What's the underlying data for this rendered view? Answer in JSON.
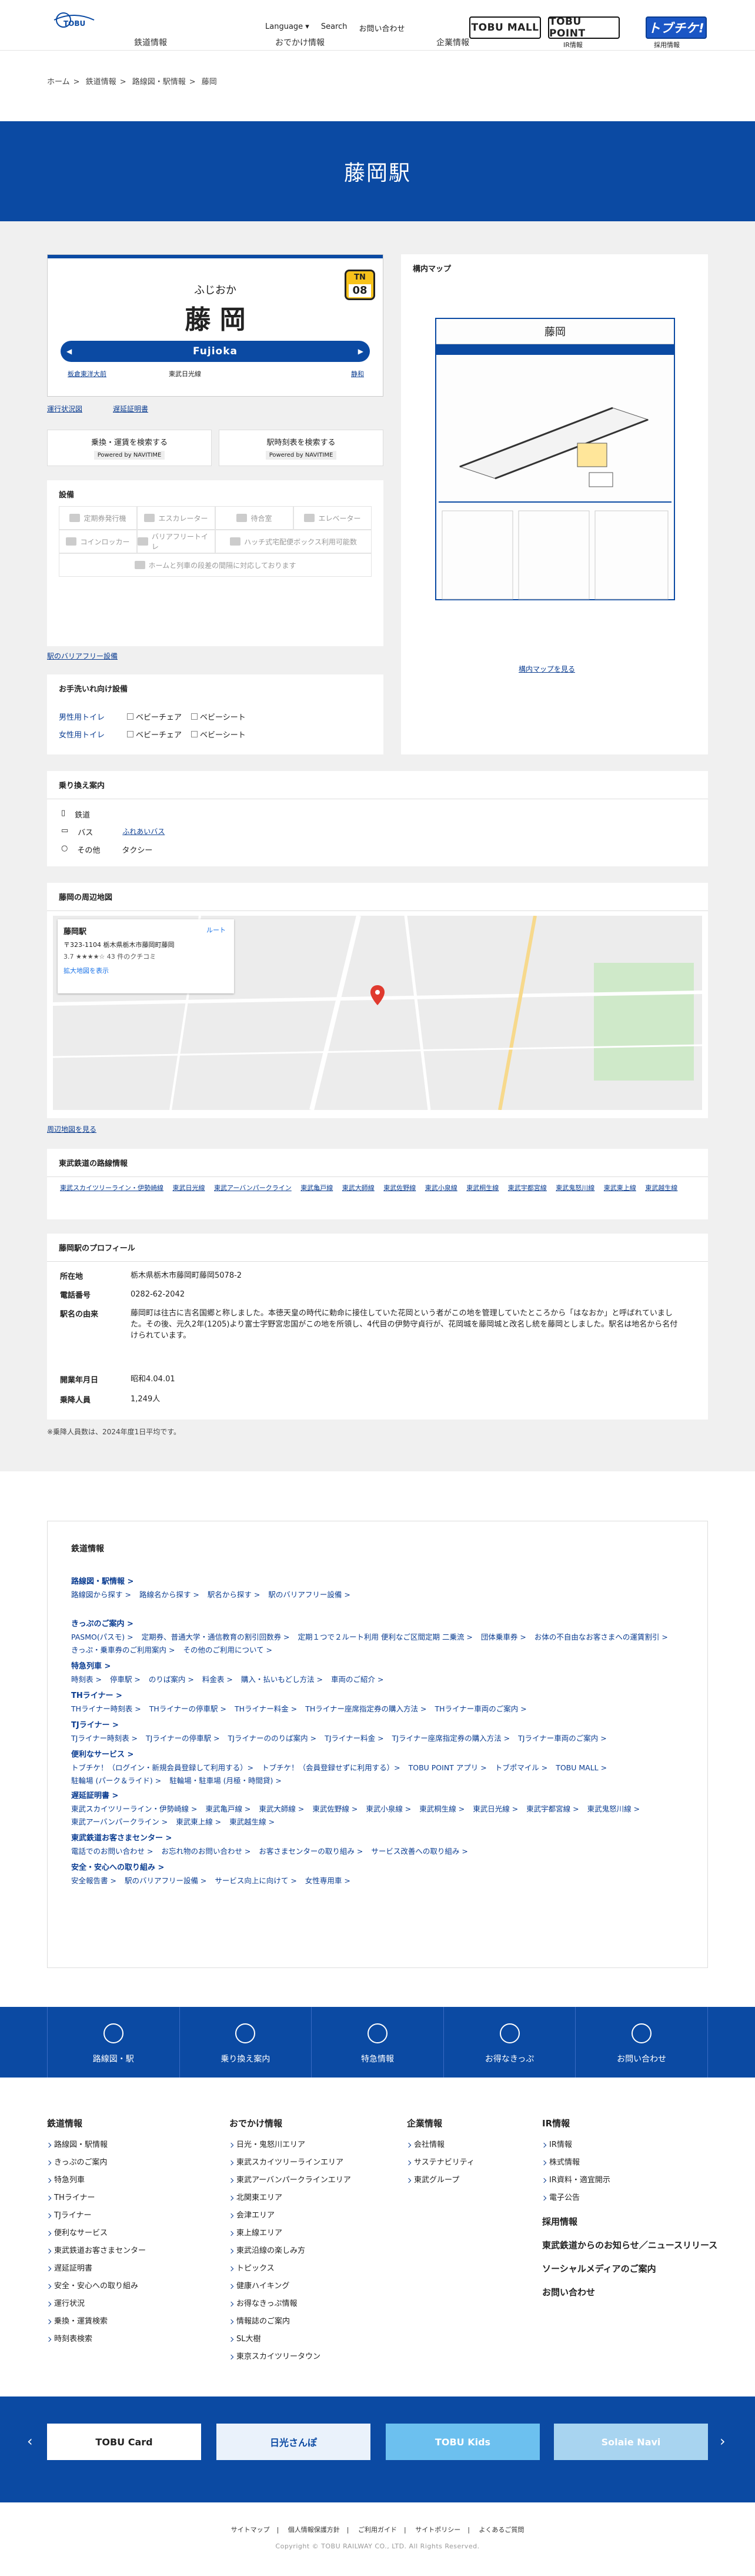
{
  "header": {
    "top": [
      "Language ▾",
      "Search",
      "お問い合わせ"
    ],
    "main": [
      "鉄道情報",
      "おでかけ情報",
      "企業情報"
    ],
    "brands": {
      "tobumall": "TOBU MALL",
      "tobupoint": "TOBU POINT",
      "topuchike": "トブチケ!"
    },
    "brand_subs": [
      "IR情報",
      "採用情報"
    ]
  },
  "breadcrumb": [
    "ホーム",
    "鉄道情報",
    "路線図・駅情報",
    "藤岡"
  ],
  "page_title": "藤岡駅",
  "sign": {
    "kana": "ふじおか",
    "kanji": "藤 岡",
    "romaji": "Fujioka",
    "code_prefix": "TN",
    "code_num": "08",
    "prev": "板倉東洋大前",
    "line": "東武日光線",
    "next": "静和"
  },
  "links": {
    "timetable": "運行状況図",
    "delay": "遅延証明書"
  },
  "search_buttons": [
    {
      "label": "乗換・運賃を検索する",
      "powered": "Powered by NAVITIME"
    },
    {
      "label": "駅時刻表を検索する",
      "powered": "Powered by NAVITIME"
    }
  ],
  "facilities": {
    "title": "設備",
    "items": [
      "定期券発行機",
      "エスカレーター",
      "待合室",
      "エレベーター",
      "コインロッカー",
      "バリアフリートイレ",
      "ハッチ式宅配便ボックス利用可能数",
      "ホームと列車の段差の間隔に対応しております"
    ],
    "link": "駅のバリアフリー設備"
  },
  "station_map": {
    "title": "構内マップ",
    "map_title": "藤岡",
    "link": "構内マップを見る"
  },
  "toilet": {
    "title": "お手洗いれ向け設備",
    "rows": [
      {
        "label": "男性用トイレ",
        "opts": [
          "ベビーチェア",
          "ベビーシート"
        ]
      },
      {
        "label": "女性用トイレ",
        "opts": [
          "ベビーチェア",
          "ベビーシート"
        ]
      }
    ]
  },
  "transfer": {
    "title": "乗り換え案内",
    "rows": [
      {
        "k": "鉄道",
        "v": ""
      },
      {
        "k": "バス",
        "v": "ふれあいバス"
      },
      {
        "k": "その他",
        "v": "タクシー"
      }
    ]
  },
  "nearmap": {
    "title": "藤岡の周辺地図",
    "info_name": "藤岡駅",
    "info_addr": "〒323-1104 栃木県栃木市藤岡町藤岡",
    "info_rating": "3.7 ★★★★☆ 43 件のクチコミ",
    "info_route": "ルート",
    "info_link": "拡大地図を表示",
    "link": "周辺地図を見る"
  },
  "routes": {
    "title": "東武鉄道の路線情報",
    "items": [
      "東武スカイツリーライン・伊勢崎線",
      "東武日光線",
      "東武アーバンパークライン",
      "東武亀戸線",
      "東武大師線",
      "東武佐野線",
      "東武小泉線",
      "東武桐生線",
      "東武宇都宮線",
      "東武鬼怒川線",
      "東武東上線",
      "東武越生線"
    ]
  },
  "profile": {
    "title": "藤岡駅のプロフィール",
    "rows": [
      {
        "k": "所在地",
        "v": "栃木県栃木市藤岡町藤岡5078-2"
      },
      {
        "k": "電話番号",
        "v": "0282-62-2042"
      },
      {
        "k": "駅名の由来",
        "v": "藤岡町は往古に吉名国郷と称しました。本徳天皇の時代に勅命に接住していた花岡という者がこの地を管理していたところから「はなおか」と呼ばれていました。その後、元久2年(1205)より富士字野宮忠国がこの地を所領し、4代目の伊勢守貞行が、花岡城を藤岡城と改名し統を藤岡としました。駅名は地名から名付けられています。"
      },
      {
        "k": "開業年月日",
        "v": "昭和4.04.01"
      },
      {
        "k": "乗降人員",
        "v": "1,249人"
      }
    ],
    "note": "※乗降人員数は、2024年度1日平均です。"
  },
  "railinfo": {
    "title": "鉄道情報",
    "groups": [
      {
        "t": "路線図・駅情報 >",
        "links": [
          "路線図から探す >",
          "路線名から探す >",
          "駅名から探す >",
          "駅のバリアフリー設備 >"
        ]
      },
      {
        "t": "きっぷのご案内 >",
        "links": [
          "PASMO(パスモ) >",
          "定期券、普通大学・通信教育の割引回数券 >",
          "定期１つで２ルート利用 便利なご区間定期 二乗流 >",
          "団体乗車券 >",
          "お体の不自由なお客さまへの運賃割引 >",
          "きっぷ・乗車券のご利用案内 >",
          "その他のご利用について >"
        ]
      },
      {
        "t": "特急列車 >",
        "links": [
          "時刻表 >",
          "停車駅 >",
          "のりば案内 >",
          "料金表 >",
          "購入・払いもどし方法 >",
          "車両のご紹介 >"
        ]
      },
      {
        "t": "THライナー >",
        "links": [
          "THライナー時刻表 >",
          "THライナーの停車駅 >",
          "THライナー料金 >",
          "THライナー座席指定券の購入方法 >",
          "THライナー車両のご案内 >"
        ]
      },
      {
        "t": "TJライナー >",
        "links": [
          "TJライナー時刻表 >",
          "TJライナーの停車駅 >",
          "TJライナーののりば案内 >",
          "TJライナー料金 >",
          "TJライナー座席指定券の購入方法 >",
          "TJライナー車両のご案内 >"
        ]
      },
      {
        "t": "便利なサービス >",
        "links": [
          "トブチケ！（ログイン・新規会員登録して利用する）>",
          "トブチケ！（会員登録せずに利用する）>",
          "TOBU POINT アプリ >",
          "トブポマイル >",
          "TOBU MALL >",
          "駐輪場 (パーク＆ライド) >",
          "駐輪場・駐車場 (月極・時間貸) >"
        ]
      },
      {
        "t": "遅延証明書 >",
        "links": [
          "東武スカイツリーライン・伊勢崎線 >",
          "東武亀戸線 >",
          "東武大師線 >",
          "東武佐野線 >",
          "東武小泉線 >",
          "東武桐生線 >",
          "東武日光線 >",
          "東武宇都宮線 >",
          "東武鬼怒川線 >",
          "東武アーバンパークライン >",
          "東武東上線 >",
          "東武越生線 >"
        ]
      },
      {
        "t": "東武鉄道お客さまセンター >",
        "links": [
          "電話でのお問い合わせ >",
          "お忘れ物のお問い合わせ >",
          "お客さまセンターの取り組み >",
          "サービス改善への取り組み >"
        ]
      },
      {
        "t": "安全・安心への取り組み >",
        "links": [
          "安全報告書 >",
          "駅のバリアフリー設備 >",
          "サービス向上に向けて >",
          "女性専用車 >"
        ]
      }
    ]
  },
  "band": [
    "路線図・駅",
    "乗り換え案内",
    "特急情報",
    "お得なきっぷ",
    "お問い合わせ"
  ],
  "footer": {
    "col1": {
      "h": "鉄道情報",
      "items": [
        "路線図・駅情報",
        "きっぷのご案内",
        "特急列車",
        "THライナー",
        "TJライナー",
        "便利なサービス",
        "東武鉄道お客さまセンター",
        "遅延証明書",
        "安全・安心への取り組み",
        "運行状況",
        "乗換・運賃検索",
        "時刻表検索"
      ]
    },
    "col2": {
      "h": "おでかけ情報",
      "items": [
        "日光・鬼怒川エリア",
        "東武スカイツリーラインエリア",
        "東武アーバンパークラインエリア",
        "北関東エリア",
        "会津エリア",
        "東上線エリア",
        "東武沿線の楽しみ方",
        "トピックス",
        "健康ハイキング",
        "お得なきっぷ情報",
        "情報誌のご案内",
        "SL大樹",
        "東京スカイツリータウン"
      ]
    },
    "col3": {
      "h": "企業情報",
      "items": [
        "会社情報",
        "サステナビリティ",
        "東武グループ"
      ]
    },
    "col4": {
      "h": "IR情報",
      "items": [
        "IR情報",
        "株式情報",
        "IR資料・適宜開示",
        "電子公告"
      ],
      "extra": [
        "採用情報",
        "東武鉄道からのお知らせ／ニュースリリース",
        "ソーシャルメディアのご案内",
        "お問い合わせ"
      ]
    }
  },
  "banners": [
    "TOBU Card",
    "日光さんぽ",
    "TOBU Kids",
    "Solaie Navi"
  ],
  "footer_links": [
    "サイトマップ",
    "個人情報保護方針",
    "ご利用ガイド",
    "サイトポリシー",
    "よくあるご質問"
  ],
  "copyright": "Copyright © TOBU RAILWAY CO., LTD. All Rights Reserved."
}
